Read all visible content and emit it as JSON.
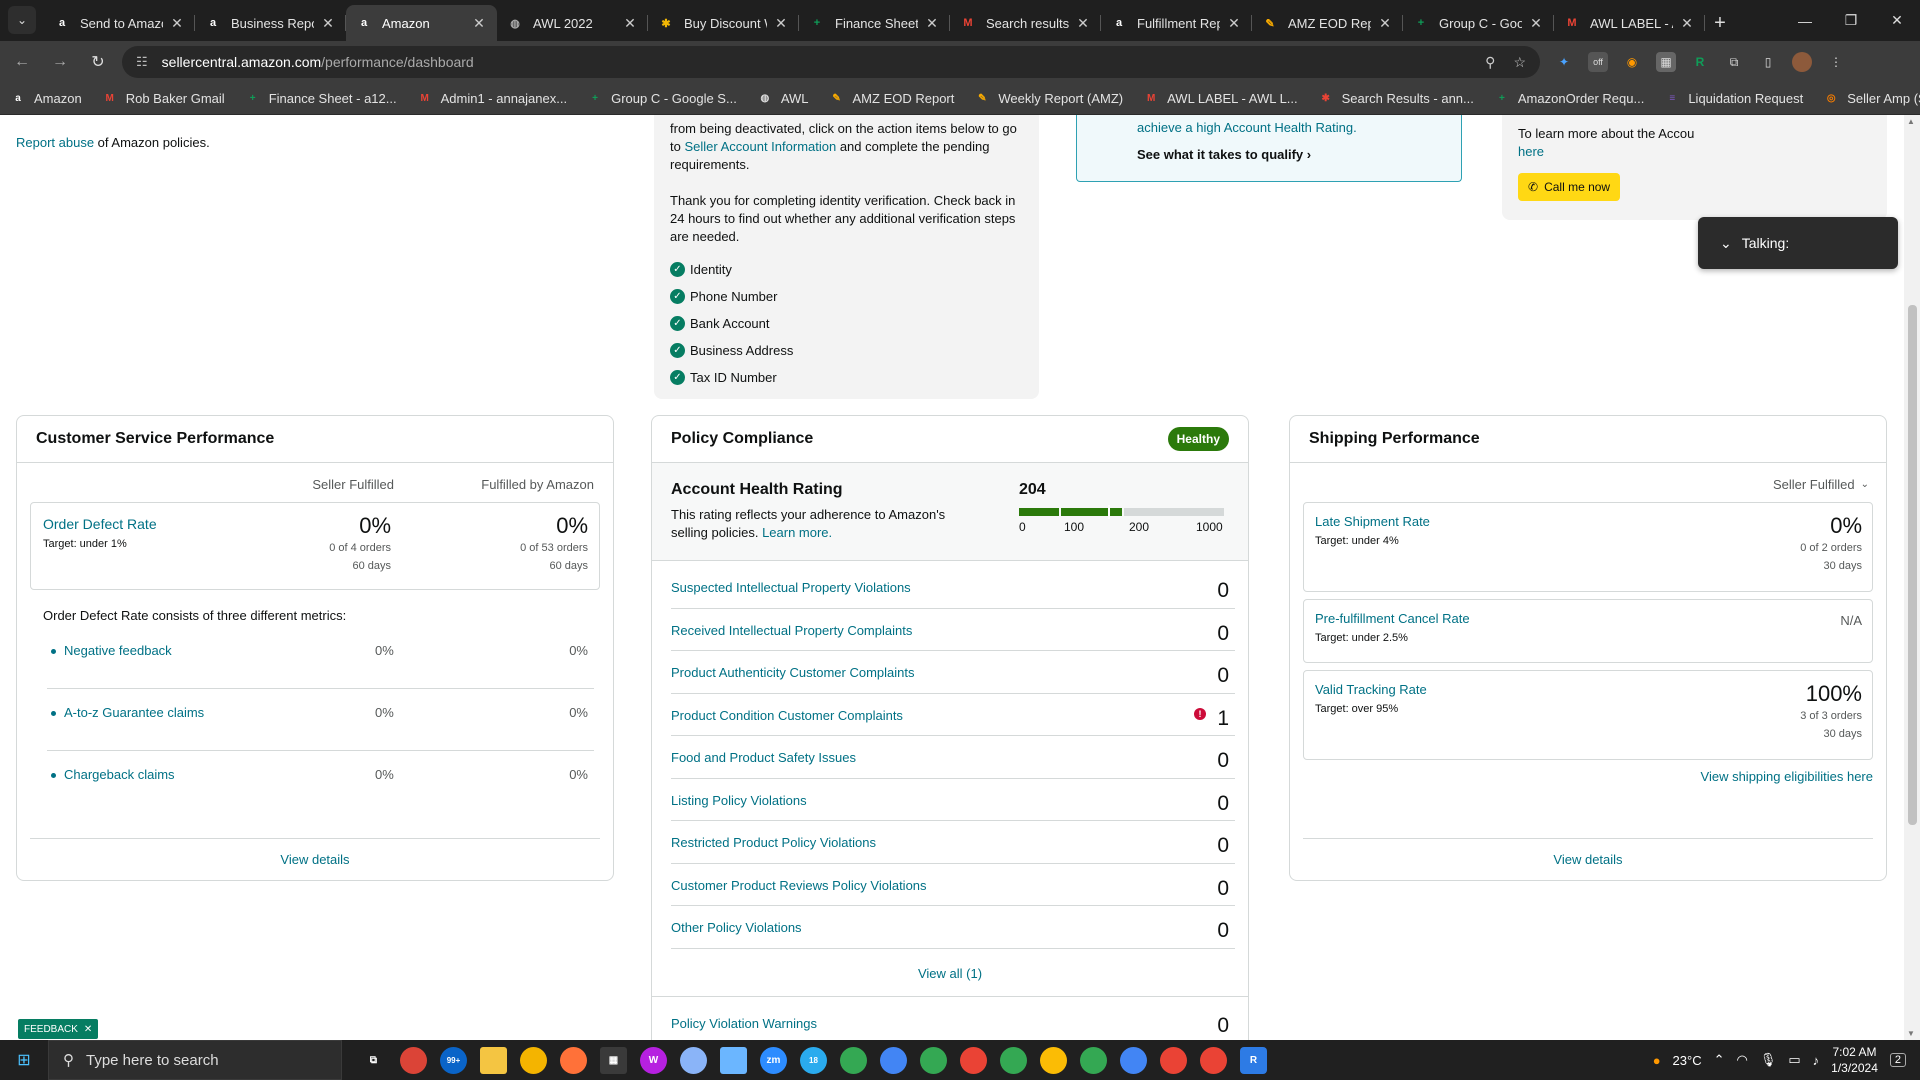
{
  "browser": {
    "tabs": [
      {
        "title": "Send to Amazon",
        "icon": "amazon-icon",
        "color": "#ffffff",
        "glyph": "a"
      },
      {
        "title": "Business Reports",
        "icon": "amazon-icon",
        "color": "#ffffff",
        "glyph": "a"
      },
      {
        "title": "Amazon",
        "icon": "amazon-icon",
        "color": "#ffffff",
        "glyph": "a",
        "active": true
      },
      {
        "title": "AWL 2022",
        "icon": "globe-icon",
        "color": "#aaaaaa",
        "glyph": "◍"
      },
      {
        "title": "Buy Discount Walmart",
        "icon": "walmart-icon",
        "color": "#f2b705",
        "glyph": "✱"
      },
      {
        "title": "Finance Sheet",
        "icon": "sheets-icon",
        "color": "#0f9d58",
        "glyph": "+"
      },
      {
        "title": "Search results",
        "icon": "gmail-icon",
        "color": "#ea4335",
        "glyph": "M"
      },
      {
        "title": "Fulfillment Reports",
        "icon": "amazon-icon",
        "color": "#ffffff",
        "glyph": "a"
      },
      {
        "title": "AMZ EOD Report",
        "icon": "pen-icon",
        "color": "#f9ab00",
        "glyph": "✎"
      },
      {
        "title": "Group C - Google",
        "icon": "sheets-icon",
        "color": "#0f9d58",
        "glyph": "+"
      },
      {
        "title": "AWL LABEL - AWL",
        "icon": "gmail-icon",
        "color": "#ea4335",
        "glyph": "M"
      }
    ],
    "url_host": "sellercentral.amazon.com",
    "url_path": "/performance/dashboard",
    "bookmarks": [
      {
        "label": "Amazon",
        "color": "#ffffff",
        "glyph": "a"
      },
      {
        "label": "Rob Baker Gmail",
        "color": "#ea4335",
        "glyph": "M"
      },
      {
        "label": "Finance Sheet - a12...",
        "color": "#0f9d58",
        "glyph": "+"
      },
      {
        "label": "Admin1 - annajanex...",
        "color": "#ea4335",
        "glyph": "M"
      },
      {
        "label": "Group C - Google S...",
        "color": "#0f9d58",
        "glyph": "+"
      },
      {
        "label": "AWL",
        "color": "#dddddd",
        "glyph": "◍"
      },
      {
        "label": "AMZ EOD Report",
        "color": "#f9ab00",
        "glyph": "✎"
      },
      {
        "label": "Weekly Report (AMZ)",
        "color": "#f9ab00",
        "glyph": "✎"
      },
      {
        "label": "AWL LABEL - AWL L...",
        "color": "#ea4335",
        "glyph": "M"
      },
      {
        "label": "Search Results - ann...",
        "color": "#ea4335",
        "glyph": "✱"
      },
      {
        "label": "AmazonOrder Requ...",
        "color": "#0f9d58",
        "glyph": "+"
      },
      {
        "label": "Liquidation Request",
        "color": "#7e57c2",
        "glyph": "≡"
      },
      {
        "label": "Seller Amp (SAS)",
        "color": "#f57c00",
        "glyph": "◎"
      }
    ]
  },
  "top": {
    "report_abuse_link": "Report abuse",
    "report_abuse_rest": " of Amazon policies.",
    "verify_p1_a": "from being deactivated, click on the action items below to go to ",
    "verify_p1_link": "Seller Account Information",
    "verify_p1_b": " and complete the pending requirements.",
    "verify_p2": "Thank you for completing identity verification. Check back in 24 hours to find out whether any additional verification steps are needed.",
    "verify_items": [
      "Identity",
      "Phone Number",
      "Bank Account",
      "Business Address",
      "Tax ID Number"
    ],
    "promo_text": "achieve a high Account Health Rating.",
    "promo_link": "See what it takes to qualify",
    "call_text": "To learn more about the Accou",
    "call_link": "here",
    "call_button": "Call me now",
    "talking": "Talking:"
  },
  "customer_service": {
    "title": "Customer Service Performance",
    "col1": "Seller Fulfilled",
    "col2": "Fulfilled by Amazon",
    "odr_title": "Order Defect Rate",
    "odr_target": "Target: under 1%",
    "odr_sf_value": "0%",
    "odr_sf_orders": "0 of 4 orders",
    "odr_sf_days": "60 days",
    "odr_fba_value": "0%",
    "odr_fba_orders": "0 of 53 orders",
    "odr_fba_days": "60 days",
    "description": "Order Defect Rate consists of three different metrics:",
    "metrics": [
      {
        "name": "Negative feedback",
        "sf": "0%",
        "fba": "0%"
      },
      {
        "name": "A-to-z Guarantee claims",
        "sf": "0%",
        "fba": "0%"
      },
      {
        "name": "Chargeback claims",
        "sf": "0%",
        "fba": "0%"
      }
    ],
    "view_details": "View details"
  },
  "policy": {
    "title": "Policy Compliance",
    "status": "Healthy",
    "ahr_title": "Account Health Rating",
    "ahr_desc": "This rating reflects your adherence to Amazon's selling policies.",
    "ahr_learn_more": "Learn more.",
    "ahr_score": "204",
    "ahr_ticks": [
      "0",
      "100",
      "200",
      "1000"
    ],
    "ahr_colors": {
      "red": "#cc0c39",
      "green": "#2b7a0b",
      "gray": "#d5d9d9"
    },
    "rows": [
      {
        "name": "Suspected Intellectual Property Violations",
        "value": "0"
      },
      {
        "name": "Received Intellectual Property Complaints",
        "value": "0"
      },
      {
        "name": "Product Authenticity Customer Complaints",
        "value": "0"
      },
      {
        "name": "Product Condition Customer Complaints",
        "value": "1",
        "alert": true
      },
      {
        "name": "Food and Product Safety Issues",
        "value": "0"
      },
      {
        "name": "Listing Policy Violations",
        "value": "0"
      },
      {
        "name": "Restricted Product Policy Violations",
        "value": "0"
      },
      {
        "name": "Customer Product Reviews Policy Violations",
        "value": "0"
      },
      {
        "name": "Other Policy Violations",
        "value": "0"
      }
    ],
    "view_all": "View all (1)",
    "warnings_label": "Policy Violation Warnings",
    "warnings_value": "0"
  },
  "shipping": {
    "title": "Shipping Performance",
    "filter": "Seller Fulfilled",
    "late_title": "Late Shipment Rate",
    "late_target": "Target: under 4%",
    "late_value": "0%",
    "late_orders": "0 of 2 orders",
    "late_days": "30 days",
    "cancel_title": "Pre-fulfillment Cancel Rate",
    "cancel_target": "Target: under 2.5%",
    "cancel_value": "N/A",
    "vtr_title": "Valid Tracking Rate",
    "vtr_target": "Target: over 95%",
    "vtr_value": "100%",
    "vtr_orders": "3 of 3 orders",
    "vtr_days": "30 days",
    "eligibilities_link": "View shipping eligibilities here",
    "view_details": "View details"
  },
  "feedback_label": "FEEDBACK",
  "taskbar": {
    "search_placeholder": "Type here to search",
    "mail_badge": "99+",
    "telegram_badge": "18",
    "temperature": "23°C",
    "time": "7:02 AM",
    "date": "1/3/2024",
    "notif_count": "2"
  }
}
